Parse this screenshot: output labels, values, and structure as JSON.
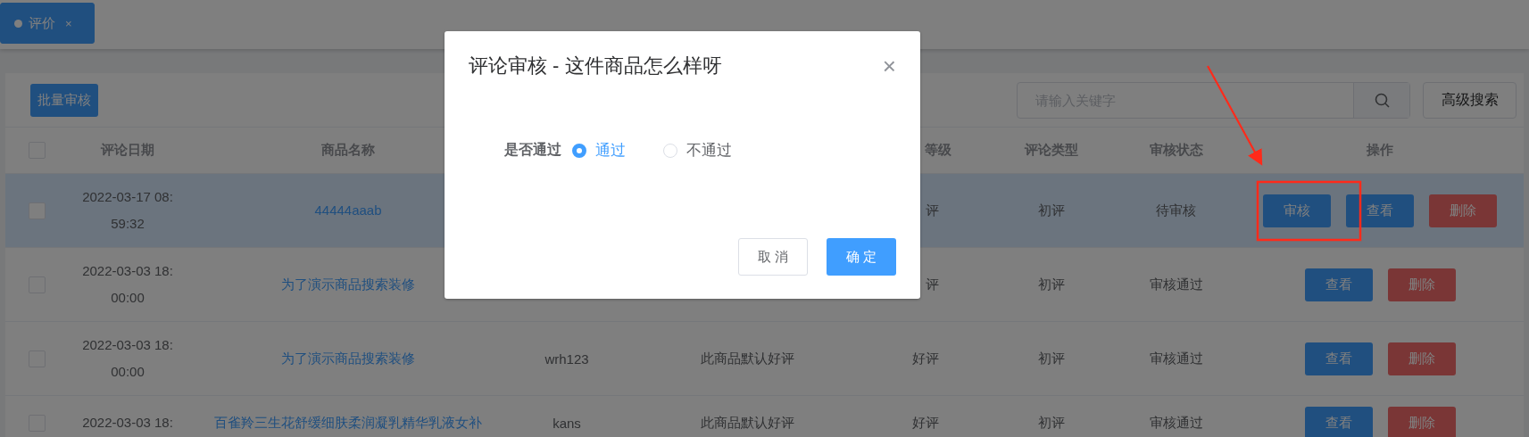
{
  "tab": {
    "label": "评价",
    "close": "×",
    "selected": true
  },
  "toolbar": {
    "batch_button": "批量审核",
    "search": {
      "placeholder": "请输入关键字"
    },
    "advanced_search": "高级搜索"
  },
  "table": {
    "header_checkbox": {
      "checked": false
    },
    "columns": [
      {
        "label": "评论日期"
      },
      {
        "label": "商品名称"
      },
      {},
      {},
      {
        "label": "等级"
      },
      {
        "label": "评论类型"
      },
      {
        "label": "审核状态"
      },
      {
        "label": "操作"
      }
    ],
    "rows": [
      {
        "checked": false,
        "highlighted": true,
        "date": "2022-03-17 08:59:32",
        "product": "44444aaab",
        "level": "评",
        "type": "初评",
        "status": "待审核",
        "actions": [
          {
            "kind": "review",
            "label": "审核"
          },
          {
            "kind": "view",
            "label": "查看"
          },
          {
            "kind": "delete",
            "label": "删除"
          }
        ]
      },
      {
        "checked": false,
        "highlighted": false,
        "date": "2022-03-03 18:00:00",
        "product": "为了演示商品搜索装修",
        "level": "评",
        "type": "初评",
        "status": "审核通过",
        "actions": [
          {
            "kind": "view",
            "label": "查看"
          },
          {
            "kind": "delete",
            "label": "删除"
          }
        ]
      },
      {
        "checked": false,
        "highlighted": false,
        "date": "2022-03-03 18:00:00",
        "product": "为了演示商品搜索装修",
        "user": "wrh123",
        "content": "此商品默认好评",
        "level": "好评",
        "type": "初评",
        "status": "审核通过",
        "actions": [
          {
            "kind": "view",
            "label": "查看"
          },
          {
            "kind": "delete",
            "label": "删除"
          }
        ]
      },
      {
        "checked": false,
        "highlighted": false,
        "date": "2022-03-03 18:",
        "product": "百雀羚三生花舒缓细肤柔润凝乳精华乳液女补",
        "user": "kans",
        "content": "此商品默认好评",
        "level": "好评",
        "type": "初评",
        "status": "审核通过",
        "actions": [
          {
            "kind": "view",
            "label": "查看"
          },
          {
            "kind": "delete",
            "label": "删除"
          }
        ]
      }
    ]
  },
  "dialog": {
    "title": "评论审核 - 这件商品怎么样呀",
    "close": "×",
    "field_label": "是否通过",
    "options": [
      {
        "label": "通过",
        "selected": true
      },
      {
        "label": "不通过",
        "selected": false
      }
    ],
    "cancel": "取 消",
    "confirm": "确 定"
  }
}
